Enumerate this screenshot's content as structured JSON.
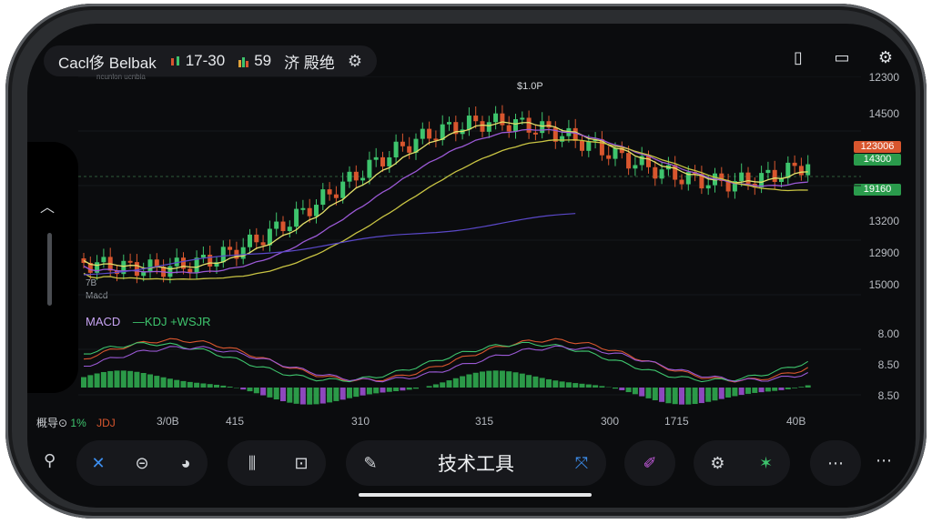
{
  "header": {
    "title": "Cacl侈 Belbak",
    "subtitle": "ncunlon ucnbia",
    "stat_time": "17-30",
    "stat_count": "59",
    "stat_text": "济 殿绝"
  },
  "price_axis": [
    "12300",
    "14500",
    "14300",
    "13200",
    "12900",
    "15000"
  ],
  "price_tags": {
    "red": "123006",
    "green": "14300",
    "green2": "19160"
  },
  "peak_label": "$1.0P",
  "left_labels": {
    "a": "7B",
    "b": "Macd"
  },
  "indicator_legend": {
    "macd": "MACD",
    "kdj": "—KDJ +WSJR"
  },
  "indicator_axis": [
    "8.00",
    "8.50",
    "8.50"
  ],
  "bottom_legend": {
    "a": "概导⊙",
    "b": "1%",
    "c": "JDJ"
  },
  "x_axis": [
    "3/0B",
    "415",
    "310",
    "315",
    "300",
    "1715",
    "40B"
  ],
  "toolbar": {
    "tech_label": "技术工具"
  },
  "colors": {
    "background": "#0b0c0e",
    "up": "#3ec46d",
    "down": "#d8562e",
    "ma_purple": "#9b59d6",
    "ma_yellow": "#c9c443",
    "ma_blue": "#5a48c8",
    "macd_pos": "#2fa84f",
    "macd_neg": "#9b4fd0"
  },
  "icons": [
    "gear-icon",
    "square-icon",
    "chat-icon",
    "settings-icon",
    "wrench-icon",
    "circle-arrow-icon",
    "pie-icon",
    "sliders-icon",
    "monitor-icon",
    "draw-icon",
    "network-icon",
    "brush-icon",
    "gear-icon",
    "star-icon",
    "more-icon"
  ]
}
